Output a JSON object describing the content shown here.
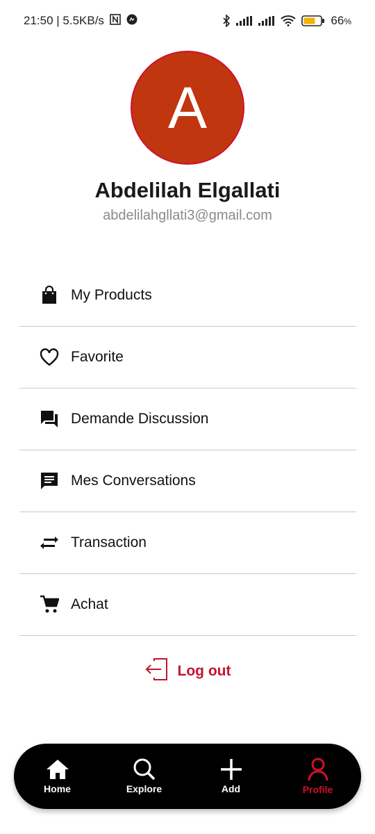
{
  "status_bar": {
    "time_speed": "21:50 | 5.5KB/s",
    "battery": "66",
    "battery_unit": "%"
  },
  "profile": {
    "initial": "A",
    "name": "Abdelilah Elgallati",
    "email": "abdelilahgllati3@gmail.com",
    "avatar_color": "#c0360f"
  },
  "menu": [
    {
      "label": "My Products",
      "icon": "shopping-bag-icon"
    },
    {
      "label": "Favorite",
      "icon": "heart-icon"
    },
    {
      "label": "Demande Discussion",
      "icon": "forum-icon"
    },
    {
      "label": "Mes Conversations",
      "icon": "chat-icon"
    },
    {
      "label": "Transaction",
      "icon": "swap-arrows-icon"
    },
    {
      "label": "Achat",
      "icon": "cart-icon"
    }
  ],
  "logout": {
    "label": "Log out",
    "color": "#c4132f"
  },
  "bottom_nav": [
    {
      "label": "Home",
      "icon": "home-icon",
      "active": false
    },
    {
      "label": "Explore",
      "icon": "search-icon",
      "active": false
    },
    {
      "label": "Add",
      "icon": "plus-icon",
      "active": false
    },
    {
      "label": "Profile",
      "icon": "user-icon",
      "active": true
    }
  ]
}
